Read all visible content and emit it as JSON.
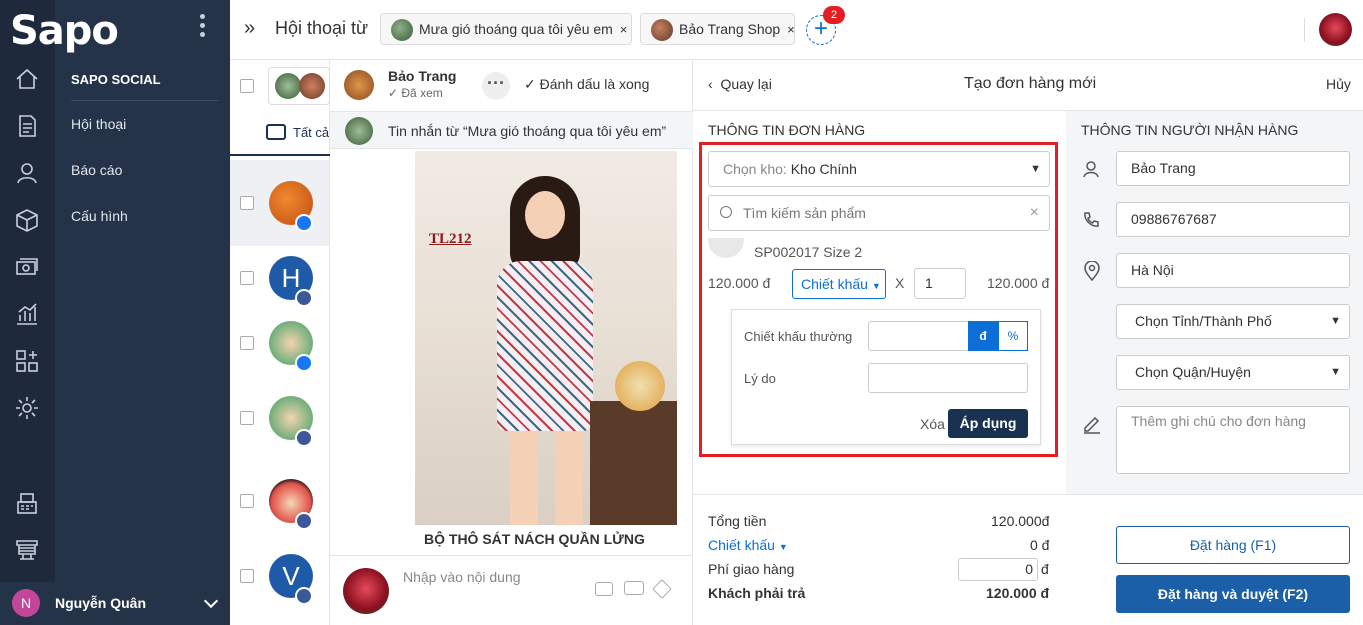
{
  "app": {
    "logo": "Sapo"
  },
  "sidebar": {
    "section_title": "SAPO SOCIAL",
    "items": [
      {
        "label": "Hội thoại"
      },
      {
        "label": "Báo cáo"
      },
      {
        "label": "Cấu hình"
      }
    ],
    "user_initial": "N",
    "user_name": "Nguyễn Quân"
  },
  "topbar": {
    "title": "Hội thoại từ",
    "tabs": [
      {
        "label": "Mưa gió thoáng qua tôi yêu em"
      },
      {
        "label": "Bảo Trang Shop"
      }
    ],
    "add_badge": "2"
  },
  "convlist": {
    "filter_label": "Tất cả"
  },
  "chat": {
    "contact_name": "Bảo Trang",
    "contact_status": "Đã xem",
    "mark_done": "Đánh dấu là xong",
    "message_from": "Tin nhắn từ  “Mưa gió thoáng qua tôi yêu em”",
    "product_code": "TL212",
    "product_caption": "BỘ THÔ SÁT NÁCH QUẦN LỬNG",
    "input_placeholder": "Nhập vào nội dung"
  },
  "order": {
    "back_label": "Quay lại",
    "title": "Tạo đơn hàng mới",
    "cancel_label": "Hủy",
    "order_info_title": "THÔNG TIN ĐƠN HÀNG",
    "warehouse_prefix": "Chọn kho:",
    "warehouse_value": "Kho Chính",
    "search_placeholder": "Tìm kiếm sản phẩm",
    "product_name": "SP002017 Size 2",
    "unit_price": "120.000 đ",
    "discount_label": "Chiết khấu",
    "multiply": "X",
    "quantity": "1",
    "line_total": "120.000 đ",
    "discount_popup": {
      "normal_label": "Chiết khấu thường",
      "unit_vnd": "đ",
      "unit_pct": "%",
      "reason_label": "Lý do",
      "delete_label": "Xóa",
      "apply_label": "Áp dụng"
    },
    "summary": {
      "total_label": "Tổng tiền",
      "total_value": "120.000đ",
      "discount_label": "Chiết khấu",
      "discount_value": "0 đ",
      "shipping_label": "Phí giao hàng",
      "shipping_value": "0",
      "shipping_unit": "đ",
      "pay_label": "Khách phải trả",
      "pay_value": "120.000 đ"
    },
    "order_button": "Đặt hàng (F1)",
    "order_approve_button": "Đặt hàng và duyệt (F2)"
  },
  "recipient": {
    "title": "THÔNG TIN NGƯỜI NHẬN HÀNG",
    "name": "Bảo Trang",
    "phone": "09886767687",
    "address": "Hà Nội",
    "province_placeholder": "Chọn Tỉnh/Thành Phố",
    "district_placeholder": "Chọn Quận/Huyện",
    "note_placeholder": "Thêm ghi chú cho đơn hàng"
  },
  "colors": {
    "highlight": "#e31e24",
    "primary": "#0b6fd6",
    "dark": "#1a3152"
  }
}
